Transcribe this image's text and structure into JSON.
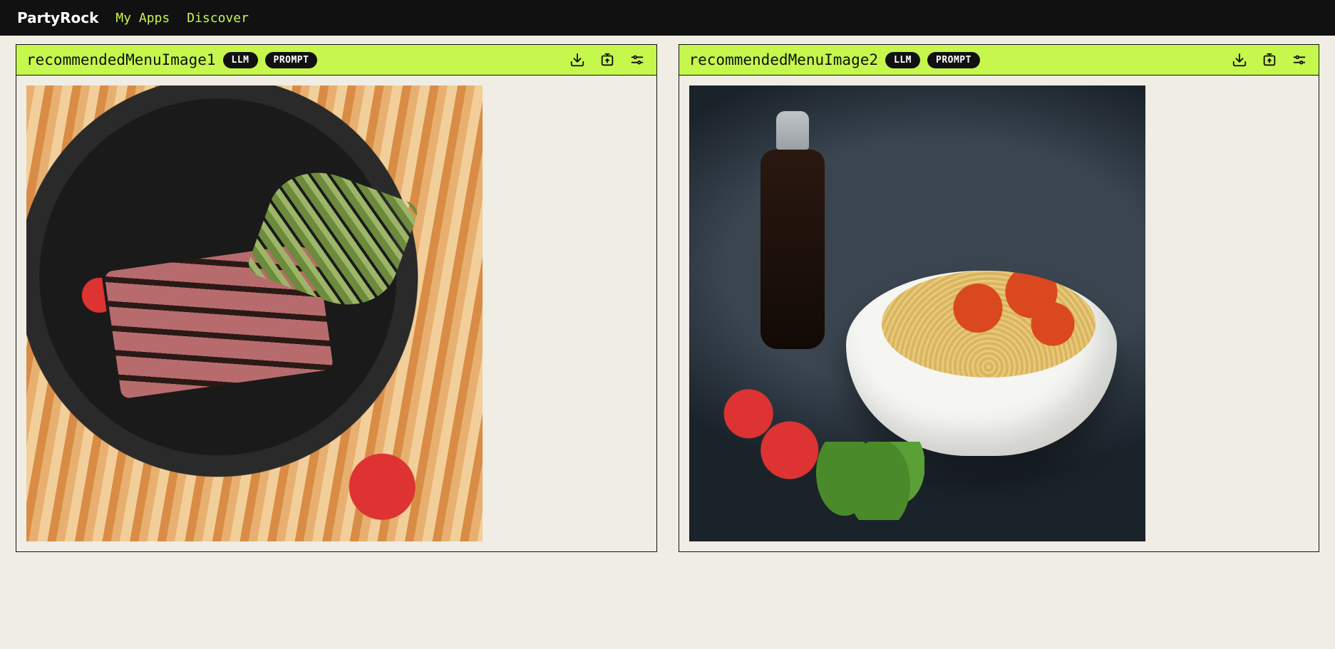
{
  "nav": {
    "brand": "PartyRock",
    "links": [
      "My Apps",
      "Discover"
    ]
  },
  "panels": [
    {
      "title": "recommendedMenuImage1",
      "badges": [
        "LLM",
        "PROMPT"
      ]
    },
    {
      "title": "recommendedMenuImage2",
      "badges": [
        "LLM",
        "PROMPT"
      ]
    }
  ]
}
